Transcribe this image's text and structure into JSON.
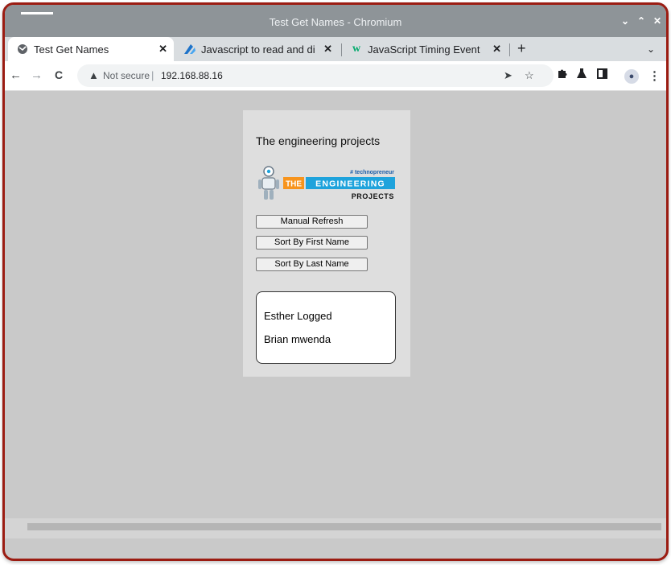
{
  "window": {
    "title": "Test Get Names - Chromium",
    "controls": [
      "⌄",
      "⌃",
      "✕"
    ]
  },
  "tabs": [
    {
      "label": "Test Get Names",
      "icon": "globe-icon",
      "active": true
    },
    {
      "label": "Javascript to read and di",
      "icon": "edge-blue-icon",
      "active": false
    },
    {
      "label": "JavaScript Timing Event",
      "icon": "w3schools-icon",
      "active": false
    }
  ],
  "tab_close_glyph": "✕",
  "new_tab_glyph": "+",
  "tablist_glyph": "⌄",
  "toolbar": {
    "back": "←",
    "forward": "→",
    "reload": "C",
    "security_text": "Not secure",
    "url": "192.168.88.16"
  },
  "page": {
    "heading": "The engineering projects",
    "logo": {
      "tagline": "# technopreneur",
      "the": "THE",
      "engineering": "ENGINEERING",
      "projects": "PROJECTS"
    },
    "buttons": {
      "refresh": "Manual Refresh",
      "sort_first": "Sort By First Name",
      "sort_last": "Sort By Last Name"
    },
    "names": [
      "Esther Logged",
      "Brian mwenda"
    ]
  },
  "colors": {
    "frame_border": "#9b1c12",
    "page_bg": "#c9c9c9",
    "card_bg": "#dedede",
    "logo_blue": "#1fa3dc",
    "logo_orange": "#f7941d"
  }
}
